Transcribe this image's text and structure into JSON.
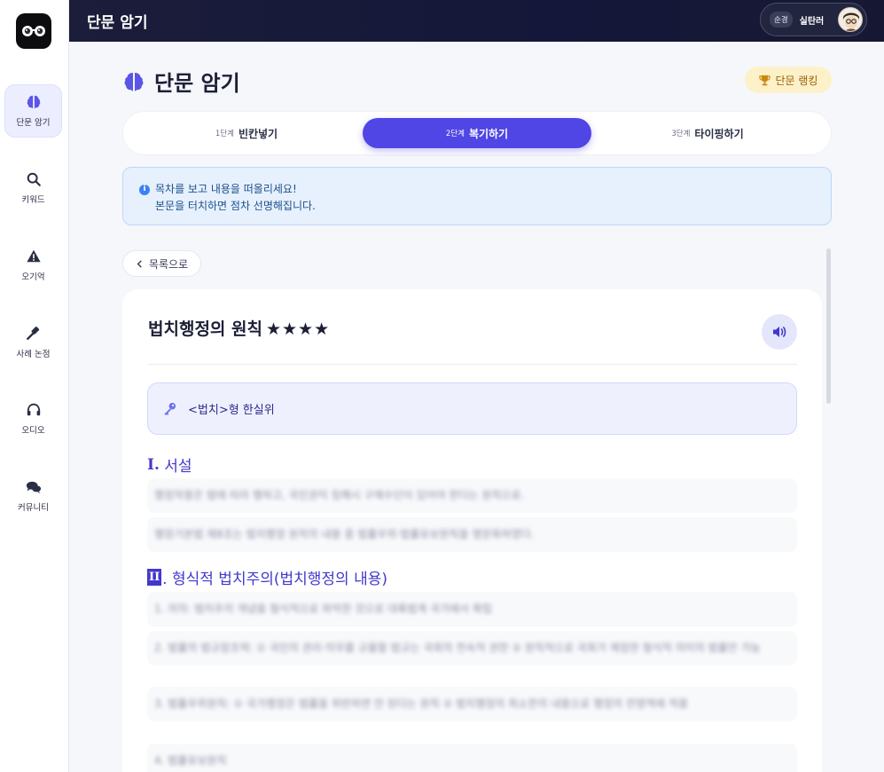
{
  "app": {
    "title": "단문 암기"
  },
  "sidebar": {
    "logo_icon": "glasses-logo",
    "items": [
      {
        "label": "단문 암기",
        "icon": "brain-icon",
        "active": true
      },
      {
        "label": "키워드",
        "icon": "search-icon",
        "active": false
      },
      {
        "label": "오기억",
        "icon": "warning-icon",
        "active": false
      },
      {
        "label": "사례 논점",
        "icon": "gavel-icon",
        "active": false
      },
      {
        "label": "오디오",
        "icon": "headphones-icon",
        "active": false
      },
      {
        "label": "커뮤니티",
        "icon": "chat-icon",
        "active": false
      }
    ]
  },
  "user": {
    "badge": "순경",
    "name": "실탄러"
  },
  "main": {
    "title": "단문 암기",
    "ranking_label": "단문 랭킹",
    "steps": [
      {
        "num": "1단계",
        "name": "빈칸넣기",
        "active": false
      },
      {
        "num": "2단계",
        "name": "복기하기",
        "active": true
      },
      {
        "num": "3단계",
        "name": "타이핑하기",
        "active": false
      }
    ],
    "info": {
      "line1": "목차를 보고 내용을 떠올리세요!",
      "line2": "본문을 터치하면 점차 선명해집니다."
    },
    "back_label": "목록으로"
  },
  "card": {
    "title": "법치행정의 원칙",
    "stars": "★★★★",
    "keyword": "<법치>형 한실위",
    "sections": [
      {
        "numeral": "I.",
        "heading": "서설",
        "rows": [
          "행정작용은 법에 따라 행하고, 국민권익 침해시 구제수단이 있어야 한다는 원칙으로.",
          "행정기본법 제8조는 법치행정 원칙의 내용 중 법률우위·법률유보원칙을 명문화하였다."
        ]
      },
      {
        "numeral": "II",
        "heading": ". 형식적 법치주의(법치행정의 내용)",
        "rows": [
          "1. 의의: 법치주의 개념을 형식적으로 파악한 것으로 대륙법계 국가에서 확립",
          "2. 법률의 법규창조력: ① 국민의 권리·의무를 규율할 법규는 국회의 전속적 권한 ② 원칙적으로 국회가 제정한 형식적 의미의 법률만 가능",
          "3. 법률우위원칙: ① 국가행정은 법률을 위반하면 안 된다는 원칙 ② 법치행정의 최소한의 내용으로 행정의 전영역에 적용",
          "4. 법률유보원칙"
        ]
      }
    ]
  },
  "colors": {
    "accent": "#4f46e5",
    "topbar": "#1b1d3a",
    "info_bg": "#e6f1fd",
    "ranking_bg": "#fdf1c9"
  }
}
